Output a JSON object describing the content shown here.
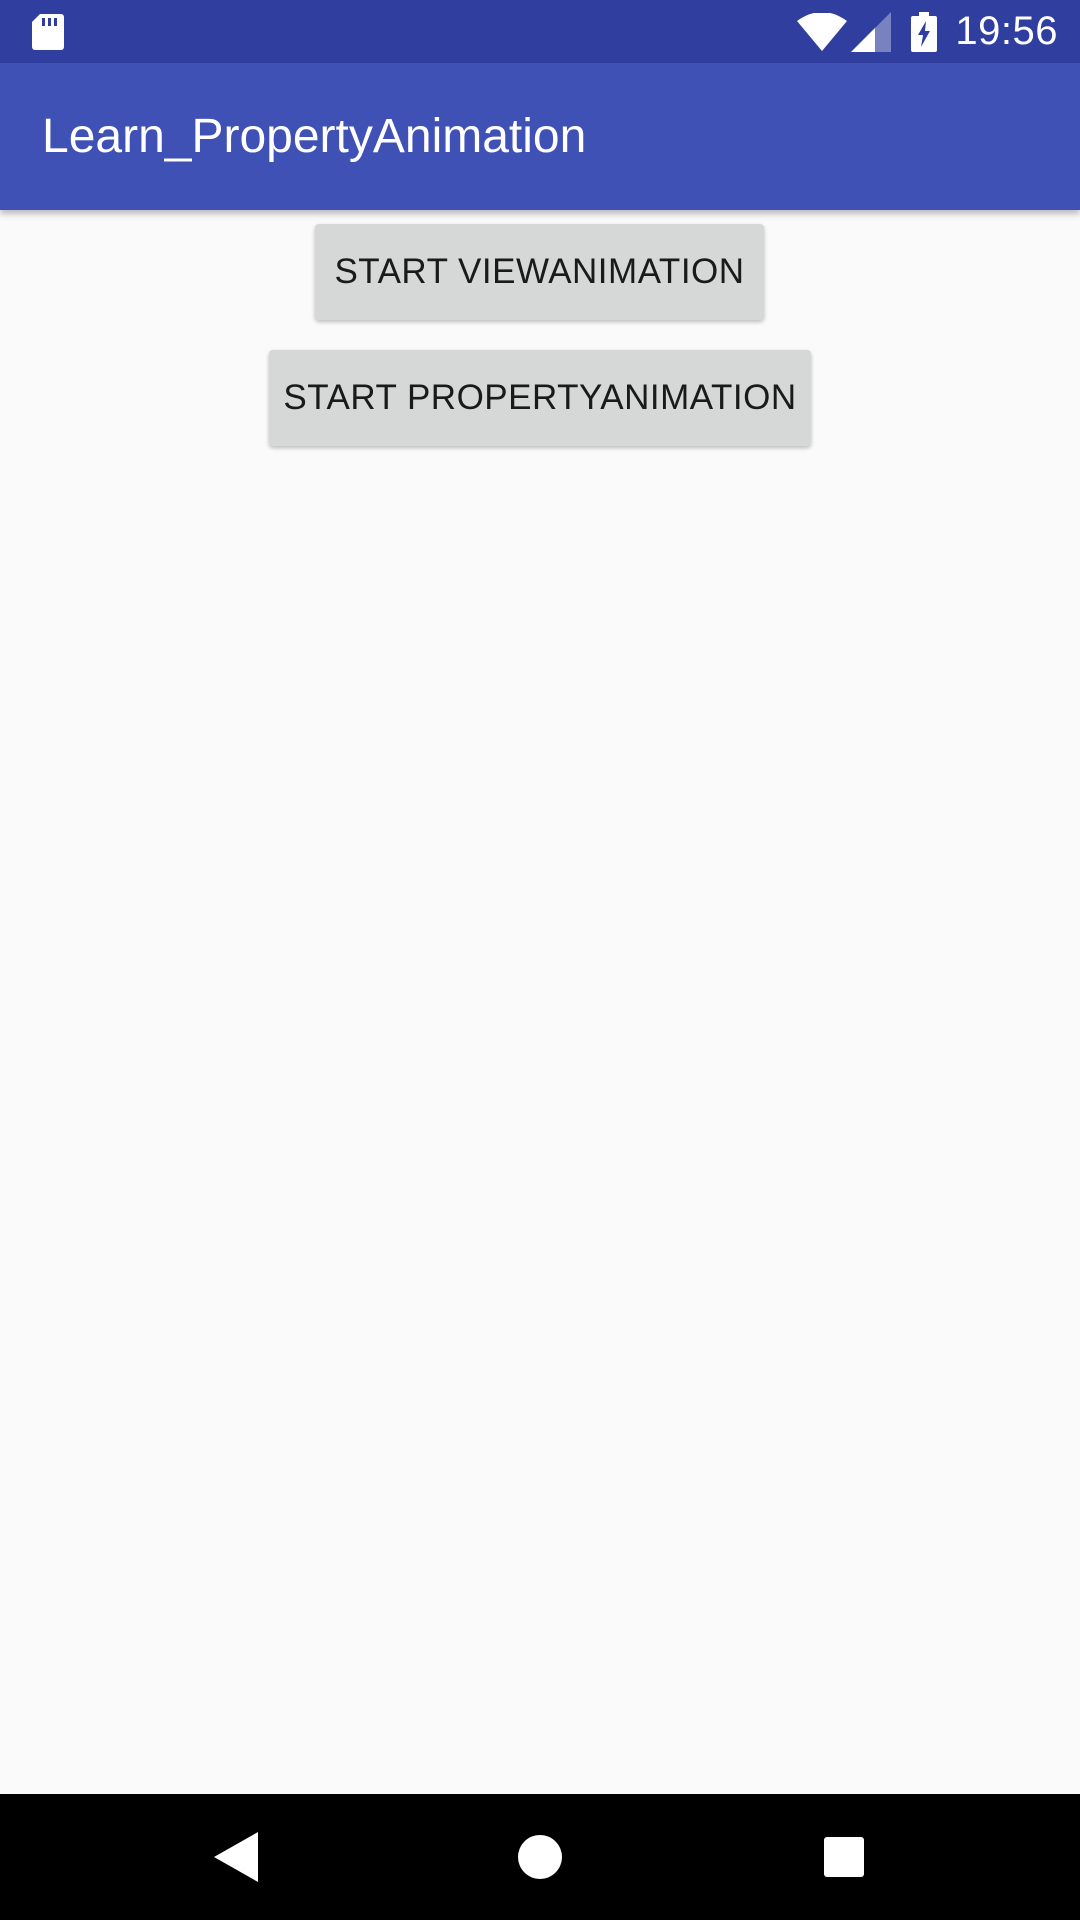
{
  "status_bar": {
    "time": "19:56",
    "icons": [
      "sd-card-icon",
      "wifi-icon",
      "cell-signal-icon",
      "battery-charging-icon"
    ]
  },
  "app_bar": {
    "title": "Learn_PropertyAnimation"
  },
  "buttons": {
    "view_animation": "START VIEWANIMATION",
    "property_animation": "START PROPERTYANIMATION"
  },
  "nav_bar": {
    "icons": [
      "back-icon",
      "home-icon",
      "recents-icon"
    ]
  },
  "colors": {
    "status_bar": "#303f9f",
    "app_bar": "#3f51b5",
    "background": "#fafafa",
    "button": "#d6d7d7",
    "nav_bar": "#000000"
  }
}
